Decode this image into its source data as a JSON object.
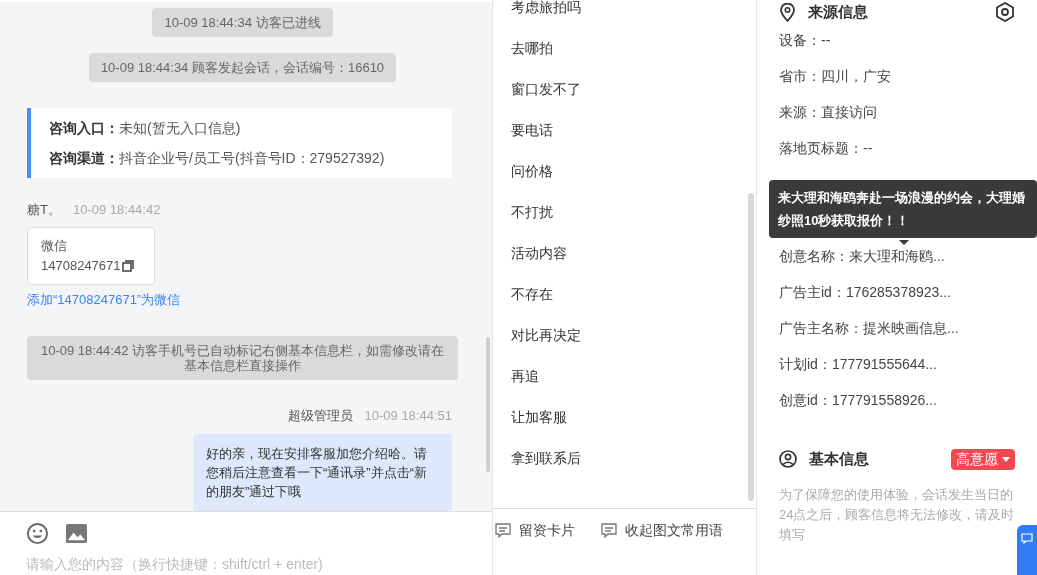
{
  "chat": {
    "messages": [
      {
        "kind": "system",
        "text": "10-09 18:44:34 访客已进线"
      },
      {
        "kind": "system",
        "text": "10-09 18:44:34 顾客发起会话，会话编号：16610"
      },
      {
        "kind": "info",
        "lines": [
          {
            "label": "咨询入口：",
            "value": "未知(暂无入口信息)"
          },
          {
            "label": "咨询渠道：",
            "value": "抖音企业号/员工号(抖音号ID：279527392)"
          }
        ]
      },
      {
        "kind": "visitor",
        "sender": "糖T。",
        "time": "10-09 18:44:42",
        "card_title": "微信",
        "card_value": "14708247671",
        "link": "添加“14708247671”为微信"
      },
      {
        "kind": "system",
        "text": "10-09 18:44:42 访客手机号已自动标记右侧基本信息栏，如需修改请在基本信息栏直接操作"
      },
      {
        "kind": "agent",
        "sender": "超级管理员",
        "time": "10-09 18:44:51",
        "text": "好的亲，现在安排客服加您介绍哈。请您稍后注意查看一下“通讯录”并点击“新的朋友”通过下哦"
      }
    ],
    "input": {
      "placeholder": "请输入您的内容（换行快捷键：shift/ctrl + enter)"
    }
  },
  "quick_replies": {
    "items": [
      "考虑旅拍吗",
      "去哪拍",
      "窗口发不了",
      "要电话",
      "问价格",
      "不打扰",
      "活动内容",
      "不存在",
      "对比再决定",
      "再追",
      "让加客服",
      "拿到联系后"
    ],
    "actions": [
      "留资卡片",
      "收起图文常用语"
    ]
  },
  "source_info": {
    "title": "来源信息",
    "rows_top": [
      "设备：--",
      "省市：四川，广安",
      "来源：直接访问",
      "落地页标题：--"
    ],
    "tooltip": "来大理和海鸥奔赴一场浪漫的约会，大理婚纱照10秒获取报价！！",
    "rows_bottom": [
      "创意名称：来大理和海鸥...",
      "广告主id：176285378923...",
      "广告主名称：提米映画信息...",
      "计划id：177791555644...",
      "创意id：177791558926..."
    ]
  },
  "basic_info": {
    "title": "基本信息",
    "intent": "高意愿",
    "note": "为了保障您的使用体验，会话发生当日的24点之后，顾客信息将无法修改，请及时填写"
  }
}
